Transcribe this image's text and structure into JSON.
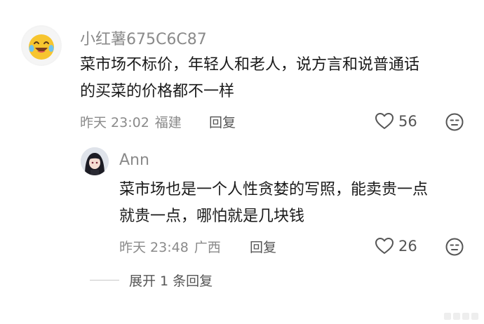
{
  "comments": [
    {
      "username": "小红薯675C6C87",
      "text_lines": [
        "菜市场不标价，年轻人和老人，说方言和说普通话",
        "的买菜的价格都不一样"
      ],
      "time": "昨天 23:02",
      "location": "福建",
      "reply_label": "回复",
      "likes": "56"
    },
    {
      "username": "Ann",
      "text_lines": [
        "菜市场也是一个人性贪婪的写照，能卖贵一点",
        "就贵一点，哪怕就是几块钱"
      ],
      "time": "昨天 23:48",
      "location": "广西",
      "reply_label": "回复",
      "likes": "26"
    }
  ],
  "expand_replies_label": "展开 1 条回复",
  "icons": {
    "like": "heart-outline-icon",
    "dislike": "unimpressed-face-icon",
    "avatar1": "laughing-emoji-avatar",
    "avatar2": "anime-girl-avatar"
  },
  "colors": {
    "meta_gray": "#8a8a8a",
    "avatar_yellow": "#f7c52f"
  }
}
